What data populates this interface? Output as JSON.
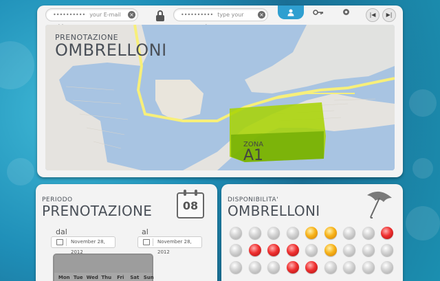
{
  "login": {
    "email_dots": "••••••••••",
    "email_placeholder": "your E-mail address",
    "password_dots": "••••••••••",
    "password_placeholder": "type your password"
  },
  "map": {
    "title_small": "PRENOTAZIONE",
    "title_big": "OMBRELLONI",
    "zone_label": "ZONA",
    "zone_id": "A1"
  },
  "periodo": {
    "title_small": "PERIODO",
    "title_big": "PRENOTAZIONE",
    "calendar_day": "08",
    "from_label": "dal",
    "to_label": "al",
    "from_date": "November 28, 2012",
    "to_date": "November 28, 2012",
    "weekdays": [
      "Mon",
      "Tue",
      "Wed",
      "Thu",
      "Fri",
      "Sat",
      "Sun"
    ]
  },
  "disponibilita": {
    "title_small": "DISPONIBILITA'",
    "title_big": "OMBRELLONI",
    "rows": [
      [
        "grey",
        "grey",
        "grey",
        "grey",
        "orange",
        "orange",
        "grey",
        "grey",
        "red"
      ],
      [
        "grey",
        "red",
        "red",
        "red",
        "grey",
        "orange",
        "grey",
        "grey",
        "grey"
      ],
      [
        "grey",
        "grey",
        "grey",
        "red",
        "red",
        "grey",
        "grey",
        "grey",
        "grey"
      ]
    ]
  },
  "colors": {
    "accent": "#2f9fd0",
    "zone": "#a8d400",
    "road": "#f7ef7a",
    "water": "#a8c4e2"
  },
  "icons": {
    "login_tab": "user-icon",
    "key_tab": "key-icon",
    "settings_tab": "gear-icon",
    "prev": "skip-back-icon",
    "next": "skip-forward-icon"
  }
}
